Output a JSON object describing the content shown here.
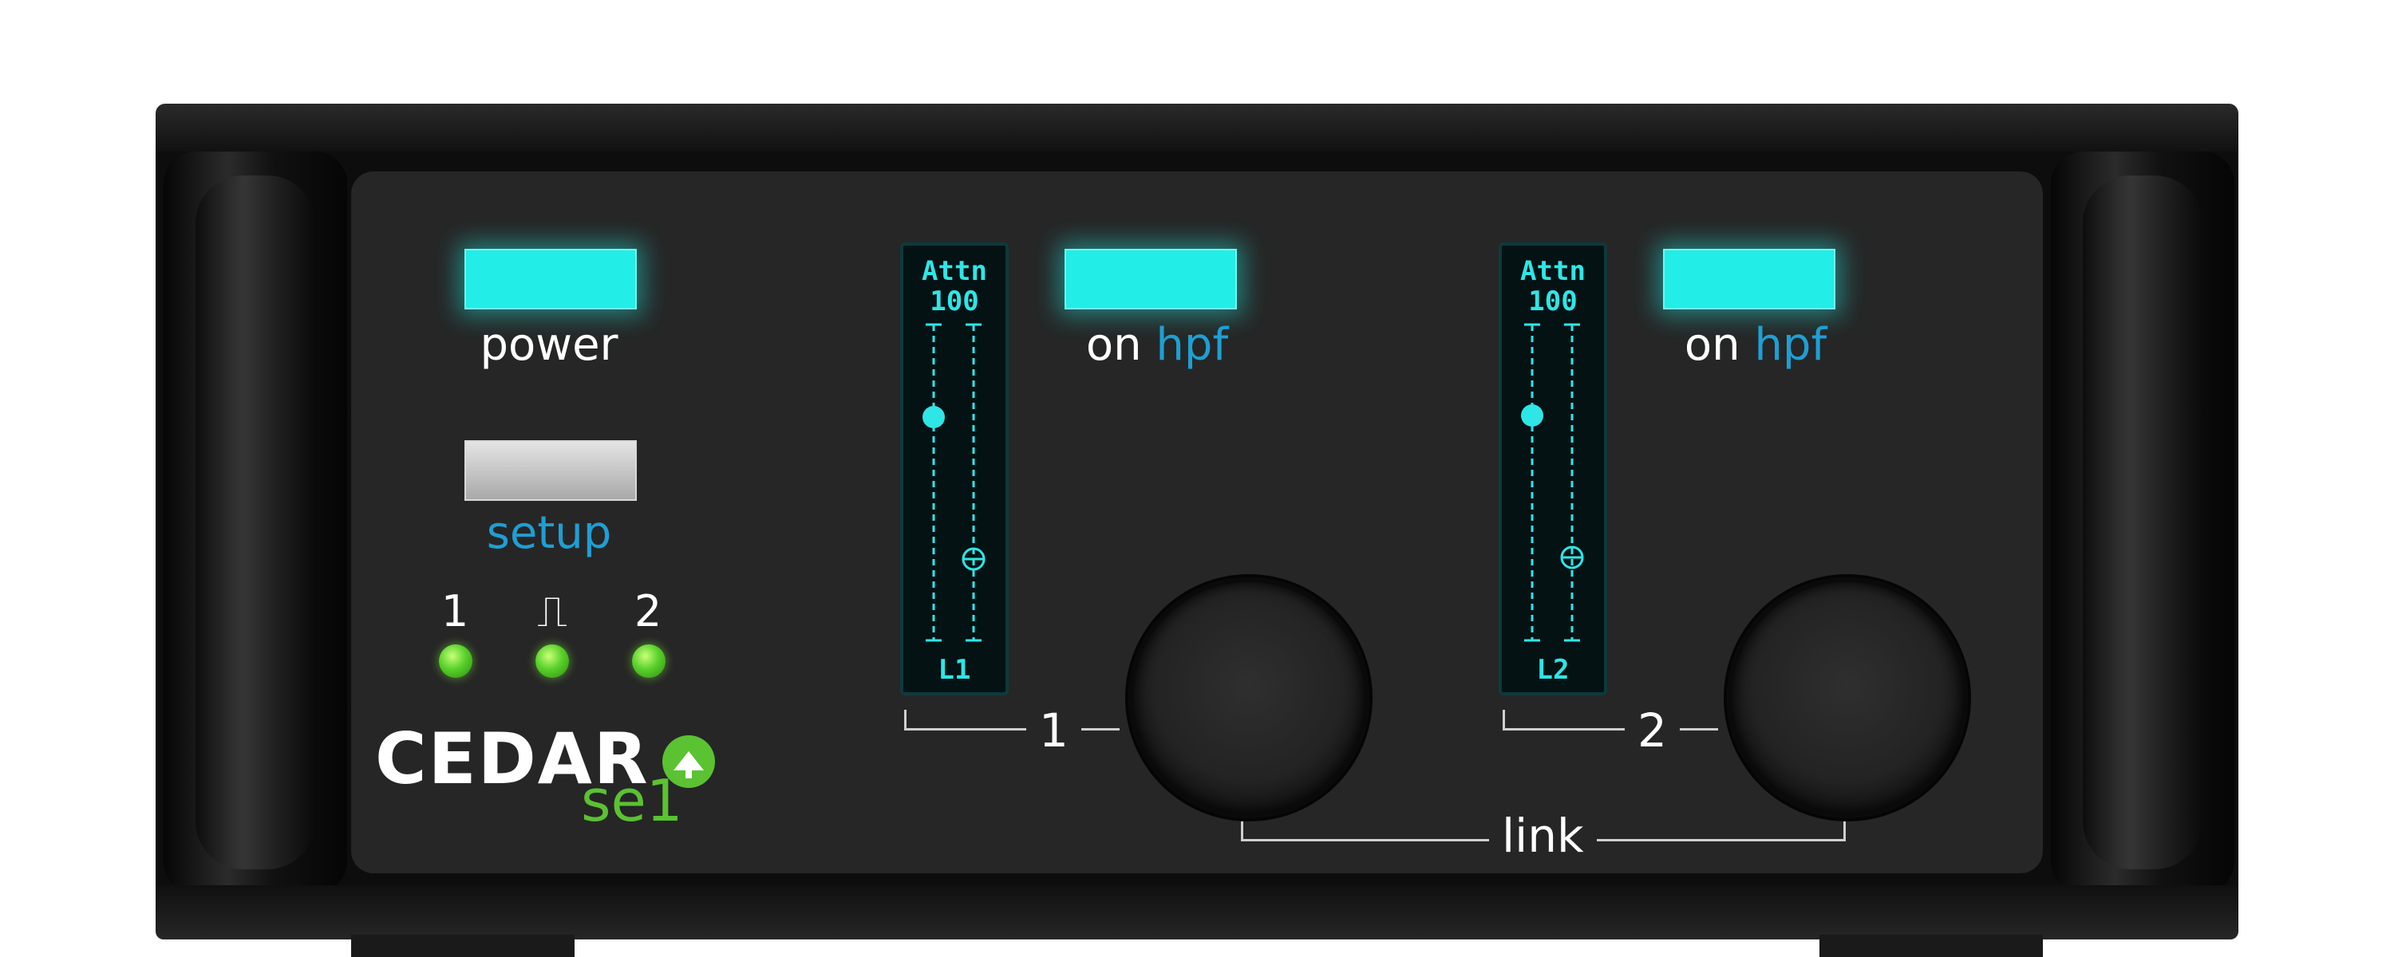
{
  "left": {
    "power_label": "power",
    "setup_label": "setup",
    "led_labels": [
      "1",
      "⎍",
      "2"
    ]
  },
  "channels": [
    {
      "meter_title": "Attn",
      "meter_value": "100",
      "meter_footer": "L1",
      "on_label": "on",
      "hpf_label": "hpf",
      "channel_label": "1"
    },
    {
      "meter_title": "Attn",
      "meter_value": "100",
      "meter_footer": "L2",
      "on_label": "on",
      "hpf_label": "hpf",
      "channel_label": "2"
    }
  ],
  "link_label": "link",
  "brand": {
    "name": "CEDAR",
    "model": "se1"
  },
  "colors": {
    "accent_cyan": "#22ede6",
    "label_blue": "#1e9fd4",
    "led_green": "#59d12a"
  }
}
